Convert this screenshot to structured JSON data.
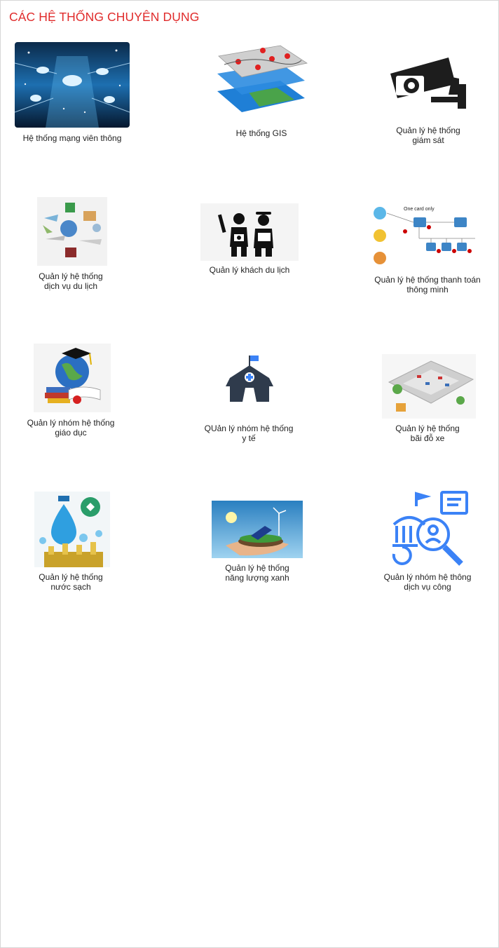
{
  "page": {
    "title": "CÁC HỆ THỐNG CHUYÊN DỤNG"
  },
  "systems": [
    {
      "icon": "telecom-network-icon",
      "label": "Hệ thống mạng viên thông"
    },
    {
      "icon": "gis-layers-map-icon",
      "label": "Hệ thống GIS"
    },
    {
      "icon": "surveillance-camera-icon",
      "label": "Quản lý hệ thống\ngiám sát"
    },
    {
      "icon": "travel-services-icon",
      "label": "Quản lý hệ thống\ndịch vụ du lịch"
    },
    {
      "icon": "tourists-icon",
      "label": "Quản lý khách du lịch"
    },
    {
      "icon": "smart-payment-diagram-icon",
      "label": "Quản lý hệ thống thanh toán\nthông minh"
    },
    {
      "icon": "education-globe-books-icon",
      "label": "Quản lý nhóm hệ thống\ngiáo dục"
    },
    {
      "icon": "hospital-tent-icon",
      "label": "QUản lý nhóm hệ thống\ny tế"
    },
    {
      "icon": "parking-lot-icon",
      "label": "Quản lý hệ thống\nbãi đỗ xe"
    },
    {
      "icon": "clean-water-icon",
      "label": "Quản lý hệ thống\nnước sạch"
    },
    {
      "icon": "green-energy-icon",
      "label": "Quản lý hệ thống\nnăng lượng xanh"
    },
    {
      "icon": "public-service-search-icon",
      "label": "Quản lý nhóm hệ thông\ndịch vụ công"
    }
  ],
  "diagram_text": {
    "one_card_only": "One card only"
  },
  "colors": {
    "title": "#e02b2b",
    "public_service_blue": "#3b82f6",
    "hospital_dark": "#2f3b4c"
  }
}
